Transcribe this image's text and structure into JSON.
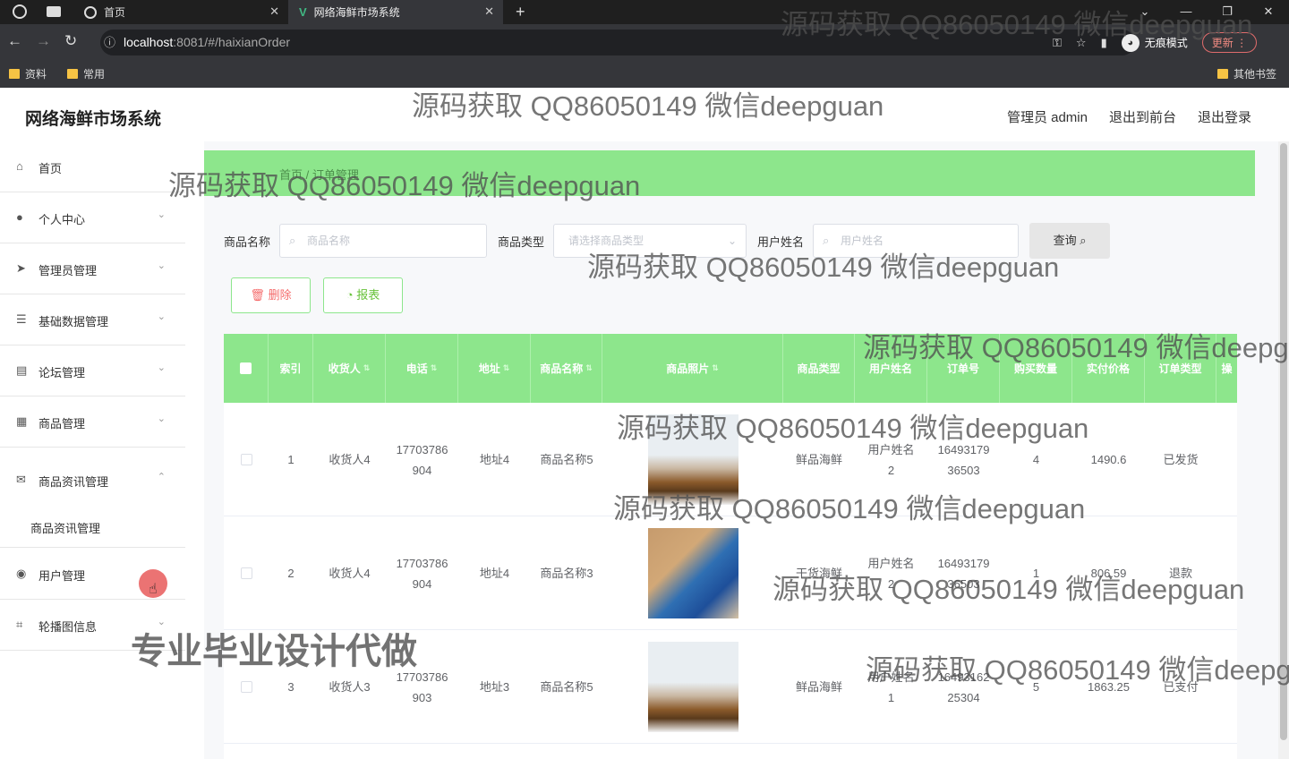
{
  "browser": {
    "tabs": [
      {
        "label": "首页"
      },
      {
        "label": "网络海鲜市场系统"
      }
    ],
    "url_host": "localhost",
    "url_path": ":8081/#/haixianOrder",
    "incognito_label": "无痕模式",
    "update_label": "更新",
    "bookmarks": [
      "资料",
      "常用"
    ],
    "other_bookmarks": "其他书签"
  },
  "app": {
    "brand": "网络海鲜市场系统",
    "header_links": [
      "管理员 admin",
      "退出到前台",
      "退出登录"
    ]
  },
  "sidebar": {
    "items": [
      {
        "label": "首页",
        "icon": "home-icon"
      },
      {
        "label": "个人中心",
        "icon": "user-icon"
      },
      {
        "label": "管理员管理",
        "icon": "send-icon"
      },
      {
        "label": "基础数据管理",
        "icon": "sliders-icon"
      },
      {
        "label": "论坛管理",
        "icon": "document-icon"
      },
      {
        "label": "商品管理",
        "icon": "grid-icon"
      },
      {
        "label": "商品资讯管理",
        "icon": "mail-icon"
      },
      {
        "label": "用户管理",
        "icon": "bulb-icon"
      },
      {
        "label": "轮播图信息",
        "icon": "crop-icon"
      }
    ],
    "sub_items": [
      "商品资讯管理"
    ]
  },
  "breadcrumb": "首页 / 订单管理",
  "search": {
    "name_label": "商品名称",
    "name_placeholder": "商品名称",
    "type_label": "商品类型",
    "type_placeholder": "请选择商品类型",
    "user_label": "用户姓名",
    "user_placeholder": "用户姓名",
    "query_label": "查询"
  },
  "actions": {
    "delete_label": "删除",
    "report_label": "报表"
  },
  "table": {
    "headers": [
      "索引",
      "收货人",
      "电话",
      "地址",
      "商品名称",
      "商品照片",
      "商品类型",
      "用户姓名",
      "订单号",
      "购买数量",
      "实付价格",
      "订单类型",
      "操"
    ],
    "rows": [
      {
        "index": "1",
        "receiver": "收货人4",
        "phone": "17703786904",
        "address": "地址4",
        "product": "商品名称5",
        "photo": "boat",
        "ptype": "鲜品海鲜",
        "user": "用户姓名2",
        "order_no": "1649317936503",
        "qty": "4",
        "price": "1490.6",
        "status": "已发货"
      },
      {
        "index": "2",
        "receiver": "收货人4",
        "phone": "17703786904",
        "address": "地址4",
        "product": "商品名称3",
        "photo": "bag",
        "ptype": "干货海鲜",
        "user": "用户姓名2",
        "order_no": "1649317936503",
        "qty": "1",
        "price": "806.59",
        "status": "退款"
      },
      {
        "index": "3",
        "receiver": "收货人3",
        "phone": "17703786903",
        "address": "地址3",
        "product": "商品名称5",
        "photo": "boat",
        "ptype": "鲜品海鲜",
        "user": "用户姓名1",
        "order_no": "1649316225304",
        "qty": "5",
        "price": "1863.25",
        "status": "已支付"
      }
    ]
  },
  "watermarks": {
    "qq": "源码获取 QQ86050149 微信deepguan",
    "bottom": "专业毕业设计代做"
  }
}
